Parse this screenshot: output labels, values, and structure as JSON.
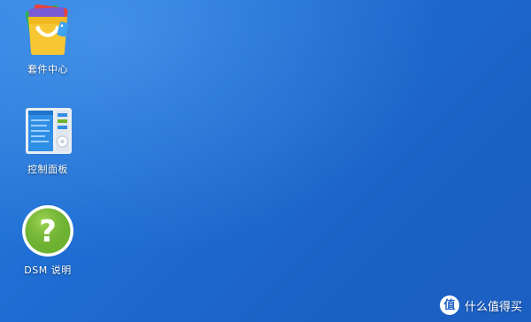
{
  "desktop": {
    "icons": [
      {
        "label": "套件中心",
        "icon": "package-center-icon"
      },
      {
        "label": "控制面板",
        "icon": "control-panel-icon"
      },
      {
        "label": "DSM 说明",
        "icon": "dsm-help-icon"
      }
    ]
  },
  "watermark": {
    "badge": "值",
    "text": "什么值得买"
  },
  "colors": {
    "desktop_bg": "#1f6ed3",
    "help_green": "#6fb331"
  }
}
